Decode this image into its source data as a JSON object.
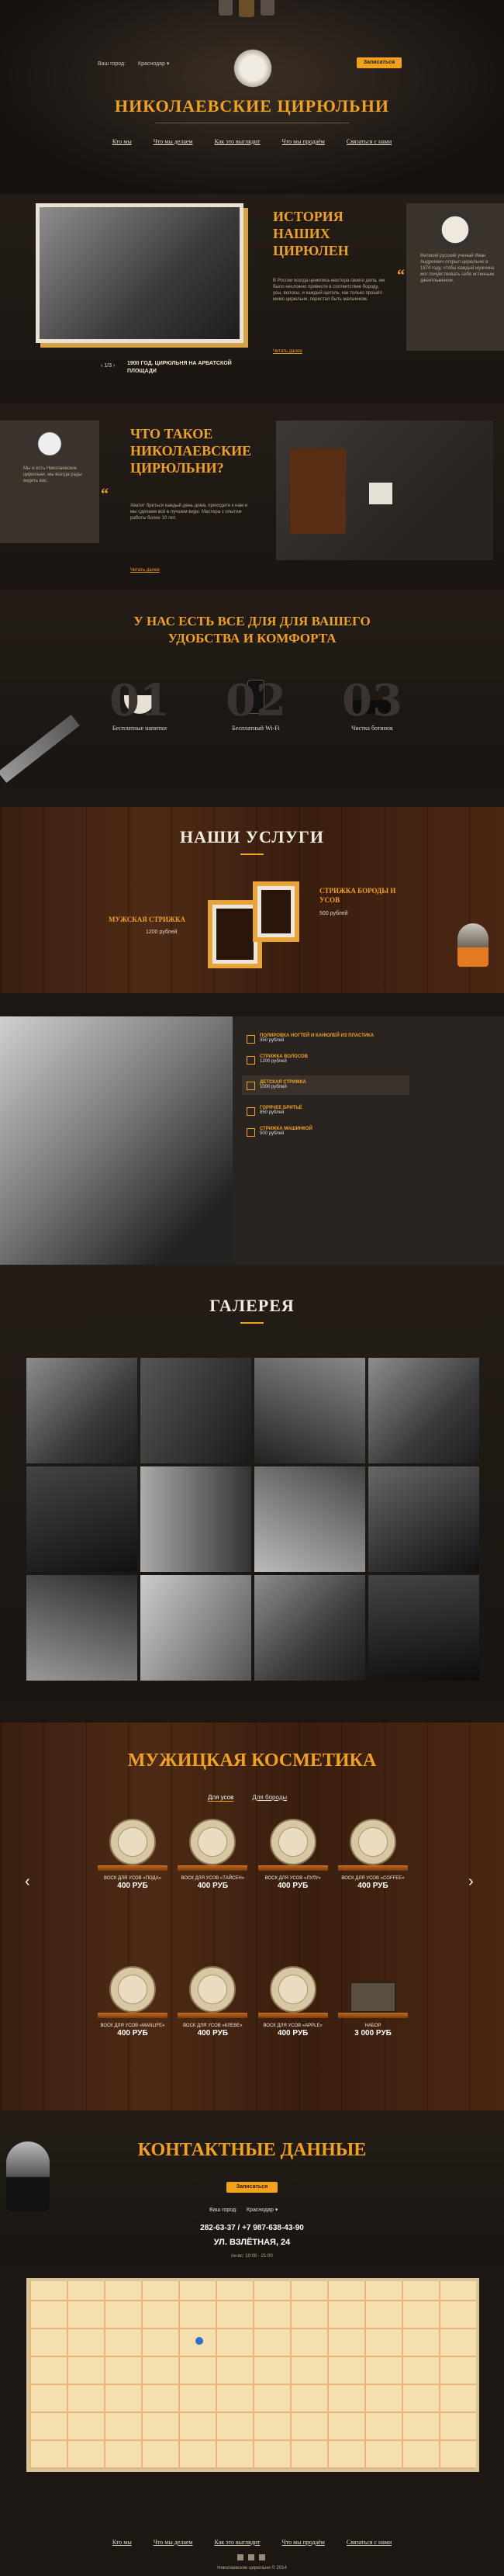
{
  "header": {
    "city_label": "Ваш город:",
    "city": "Краснодар",
    "cta": "Записаться",
    "title": "НИКОЛАЕВСКИЕ ЦИРЮЛЬНИ"
  },
  "nav": [
    "Кто мы",
    "Что мы делаем",
    "Как это выглядит",
    "Что мы продаём",
    "Связаться с нами"
  ],
  "history": {
    "heading": "ИСТОРИЯ НАШИХ ЦИРЮЛЕН",
    "text": "В России всегда ценились мастера своего дела, им было несложно привести в соответствие бороду, усы, волосы, и каждый щеголь, как только прошёл мимо цирюльни, перестал быть мальчиком.",
    "link": "Читать далее",
    "caption": "1900 ГОД. ЦИРЮЛЬНЯ НА АРБАТСКОЙ ПЛОЩАДИ",
    "pager": "1/3",
    "quote": "Великий русский ученый Иван Андреевич открыл цирюльню в 1874 году, чтобы каждый мужчина мог почувствовать себя истинным джентльменом."
  },
  "what": {
    "heading": "ЧТО ТАКОЕ НИКОЛАЕВСКИЕ ЦИРЮЛЬНИ?",
    "text": "Хватит бриться каждый день дома, приходите к нам и мы сделаем всё в лучшем виде. Мастера с опытом работы более 10 лет.",
    "link": "Читать далее",
    "quote": "Мы и есть Николаевские цирюльни, мы всегда рады видеть вас."
  },
  "comfort": {
    "heading": "У НАС ЕСТЬ ВСЕ ДЛЯ ДЛЯ ВАШЕГО УДОБСТВА И КОМФОРТА",
    "items": [
      {
        "num": "01",
        "label": "Бесплатные напитки"
      },
      {
        "num": "02",
        "label": "Бесплатный Wi-Fi"
      },
      {
        "num": "03",
        "label": "Чистка ботинок"
      }
    ]
  },
  "services": {
    "heading": "НАШИ УСЛУГИ",
    "left_title": "МУЖСКАЯ СТРИЖКА",
    "left_price": "1200 рублей",
    "right_title": "СТРИЖКА БОРОДЫ И УСОВ",
    "right_price": "500 рублей"
  },
  "service_list": [
    {
      "title": "ПОЛИРОВКА НОГТЕЙ И КАНЮЛЕЙ ИЗ ПЛАСТИКА",
      "price": "350 рублей"
    },
    {
      "title": "СТРИЖКА ВОЛОСОВ",
      "price": "1200 рублей"
    },
    {
      "title": "ДЕТСКАЯ СТРИЖКА",
      "price": "1000 рублей"
    },
    {
      "title": "ГОРЯЧЕЕ БРИТЬЁ",
      "price": "850 рублей"
    },
    {
      "title": "СТРИЖКА МАШИНКОЙ",
      "price": "500 рублей"
    }
  ],
  "gallery": {
    "heading": "ГАЛЕРЕЯ"
  },
  "cosmetics": {
    "heading": "МУЖИЦКАЯ КОСМЕТИКА",
    "tabs": [
      "Для усов",
      "Для бороды"
    ],
    "row1": [
      {
        "name": "ВОСК ДЛЯ УСОВ «ПОДА»",
        "price": "400 РУБ"
      },
      {
        "name": "ВОСК ДЛЯ УСОВ «ТАЙСЕН»",
        "price": "400 РУБ"
      },
      {
        "name": "ВОСК ДЛЯ УСОВ «ЛУЛУ»",
        "price": "400 РУБ"
      },
      {
        "name": "ВОСК ДЛЯ УСОВ «COFFEE»",
        "price": "400 РУБ"
      }
    ],
    "row2": [
      {
        "name": "ВОСК ДЛЯ УСОВ «MANLIFE»",
        "price": "400 РУБ"
      },
      {
        "name": "ВОСК ДЛЯ УСОВ «КЛЕВЕ»",
        "price": "400 РУБ"
      },
      {
        "name": "ВОСК ДЛЯ УСОВ «APPLE»",
        "price": "400 РУБ"
      },
      {
        "name": "НАБОР",
        "price": "3 000 РУБ"
      }
    ]
  },
  "contacts": {
    "heading": "КОНТАКТНЫЕ ДАННЫЕ",
    "cta": "Записаться",
    "city_label": "Ваш город:",
    "city": "Краснодар",
    "phones": "282-63-37 / +7 987-638-43-90",
    "address": "УЛ. ВЗЛЁТНАЯ, 24",
    "note": "пн-вс: 10:00 - 21:00"
  },
  "footer": {
    "nav": [
      "Кто мы",
      "Что мы делаем",
      "Как это выглядит",
      "Что мы продаём",
      "Связаться с нами"
    ],
    "copy": "Николаевские цирюльни © 2014"
  }
}
